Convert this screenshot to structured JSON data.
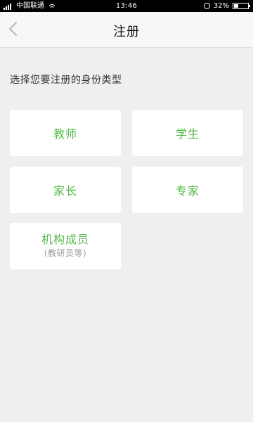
{
  "status_bar": {
    "carrier": "中国联通",
    "time": "13:46",
    "battery": "32%",
    "battery_level": 0.32,
    "icons": [
      "signal-icon",
      "wifi-icon",
      "alarm-icon",
      "battery-icon"
    ]
  },
  "header": {
    "title": "注册",
    "back_icon": "chevron-left-icon"
  },
  "main": {
    "prompt": "选择您要注册的身份类型",
    "options": [
      {
        "label": "教师"
      },
      {
        "label": "学生"
      },
      {
        "label": "家长"
      },
      {
        "label": "专家"
      },
      {
        "label": "机构成员",
        "sublabel": "(教研员等)"
      }
    ]
  },
  "colors": {
    "accent": "#53b847",
    "background": "#efefef",
    "card": "#ffffff",
    "header": "#f7f7f7",
    "status_bar": "#000000",
    "muted_text": "#999999"
  }
}
